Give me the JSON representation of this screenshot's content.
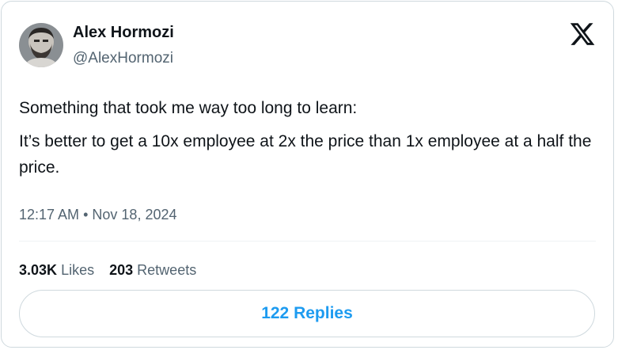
{
  "author": {
    "name": "Alex Hormozi",
    "handle": "@AlexHormozi",
    "avatar_icon": "profile-photo"
  },
  "brand": {
    "logo_icon": "x-logo-icon"
  },
  "tweet": {
    "paragraphs": [
      "Something that took me way too long to learn:",
      "It’s better to get a 10x employee at 2x the price than 1x employee at a half the price."
    ],
    "time": "12:17 AM",
    "separator": "•",
    "date": "Nov 18, 2024"
  },
  "stats": {
    "likes_count": "3.03K",
    "likes_label": "Likes",
    "retweets_count": "203",
    "retweets_label": "Retweets"
  },
  "replies_button": {
    "label": "122 Replies"
  },
  "colors": {
    "text_primary": "#0f1419",
    "text_secondary": "#536471",
    "accent": "#1d9bf0",
    "border": "#cfd9de"
  }
}
